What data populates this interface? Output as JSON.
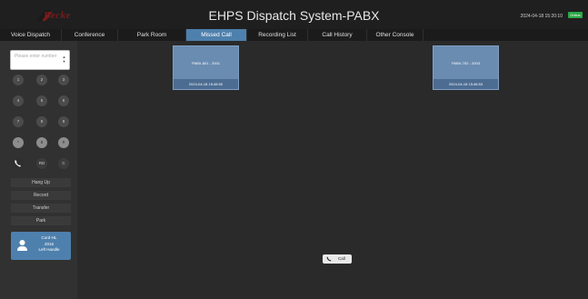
{
  "header": {
    "logo_text": "Becke",
    "title": "EHPS Dispatch System-PABX",
    "datetime": "2024-04-18 15:20:10",
    "status": "Online"
  },
  "tabs": [
    {
      "label": "Voice Dispatch",
      "active": false
    },
    {
      "label": "Conference",
      "active": false
    },
    {
      "label": "Park Room",
      "active": false
    },
    {
      "label": "Missed Call",
      "active": true
    },
    {
      "label": "Recording List",
      "active": false
    },
    {
      "label": "Call History",
      "active": false
    },
    {
      "label": "Other Console",
      "active": false
    }
  ],
  "sidebar": {
    "number_placeholder": "Please enter number",
    "keys": [
      "1",
      "2",
      "3",
      "4",
      "5",
      "6",
      "7",
      "8",
      "9",
      "*",
      "0",
      "#",
      "",
      "RD",
      "C"
    ],
    "actions": [
      "Hang Up",
      "Record",
      "Transfer",
      "Park"
    ],
    "user": {
      "name": "Cord-HL",
      "number": "2016",
      "mode": "Left Handle"
    }
  },
  "missed_calls": [
    {
      "label": "PABX-801 - 2001",
      "time": "2024-04-18 15:48:50"
    },
    {
      "label": "PABX-752 - 2003",
      "time": "2024-04-18 15:48:53"
    }
  ],
  "call_button": {
    "label": "Call"
  }
}
